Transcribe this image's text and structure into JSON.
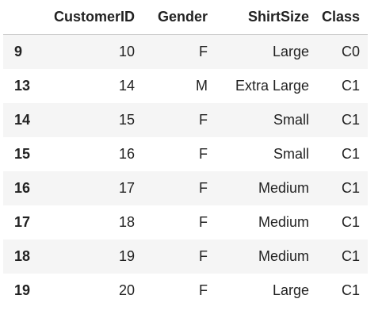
{
  "table": {
    "columns": [
      "",
      "CustomerID",
      "Gender",
      "ShirtSize",
      "Class"
    ],
    "rows": [
      {
        "index": "9",
        "cells": [
          "10",
          "F",
          "Large",
          "C0"
        ]
      },
      {
        "index": "13",
        "cells": [
          "14",
          "M",
          "Extra Large",
          "C1"
        ]
      },
      {
        "index": "14",
        "cells": [
          "15",
          "F",
          "Small",
          "C1"
        ]
      },
      {
        "index": "15",
        "cells": [
          "16",
          "F",
          "Small",
          "C1"
        ]
      },
      {
        "index": "16",
        "cells": [
          "17",
          "F",
          "Medium",
          "C1"
        ]
      },
      {
        "index": "17",
        "cells": [
          "18",
          "F",
          "Medium",
          "C1"
        ]
      },
      {
        "index": "18",
        "cells": [
          "19",
          "F",
          "Medium",
          "C1"
        ]
      },
      {
        "index": "19",
        "cells": [
          "20",
          "F",
          "Large",
          "C1"
        ]
      }
    ]
  }
}
